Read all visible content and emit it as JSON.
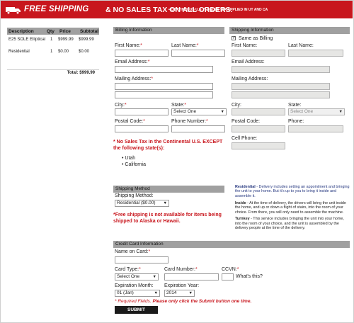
{
  "banner": {
    "free_shipping": "FREE SHIPPING",
    "no_sales_tax": "& NO SALES TAX ON ALL ORDERS.",
    "fine_print": "• CONTINUOUS U.S. ** SALES TAX APPLIED IN UT AND CA"
  },
  "cart": {
    "headers": {
      "description": "Description",
      "qty": "Qty",
      "price": "Price",
      "subtotal": "Subtotal"
    },
    "rows": [
      {
        "description": "E25 SOLE Elliptical",
        "qty": "1",
        "price": "$999.99",
        "subtotal": "$999.99"
      },
      {
        "description": "Residential",
        "qty": "1",
        "price": "$0.00",
        "subtotal": "$0.00"
      }
    ],
    "total_label": "Total: $999.99"
  },
  "billing": {
    "title": "Billing Information",
    "first_name": "First Name:",
    "last_name": "Last Name:",
    "email": "Email Address:",
    "mailing": "Mailing Address:",
    "city": "City:",
    "state": "State:",
    "state_value": "Select One",
    "postal": "Postal Code:",
    "phone": "Phone Number:"
  },
  "shipping": {
    "title": "Shipping Information",
    "same_as_billing": "Same as Billing",
    "first_name": "First Name:",
    "last_name": "Last Name:",
    "email": "Email Address:",
    "mailing": "Mailing Address:",
    "city": "City:",
    "state": "State:",
    "state_value": "Select One",
    "postal": "Postal Code:",
    "phone": "Phone:",
    "cell": "Cell Phone:"
  },
  "tax_note": {
    "line1": "* No Sales Tax in the Continental U.S. EXCEPT",
    "line2": "the following state(s):",
    "states": [
      "Utah",
      "California"
    ]
  },
  "shipping_method": {
    "title": "Shipping Method",
    "label": "Shipping Method:",
    "value": "Residential ($0.00)",
    "note_line1": "*Free shipping is not available for items being",
    "note_line2": "shipped to Alaska or Hawaii."
  },
  "delivery_info": {
    "residential_title": "Residential",
    "residential_text": " - Delivery includes setting an appointment and bringing the unit to your home. But it's up to you to bring it inside and assemble it.",
    "inside_title": "Inside",
    "inside_text": " - At the time of delivery, the drivers will bring the unit inside the home, and up or down a flight of stairs, into the room of your choice. From there, you will only need to assemble the machine.",
    "turnkey_title": "Turnkey",
    "turnkey_text": " - This service includes bringing the unit into your home, into the room of your choice, and the unit is assembled by the delivery people at the time of the delivery."
  },
  "credit_card": {
    "title": "Credit Card Information",
    "name_on_card": "Name on Card:",
    "card_type": "Card Type:",
    "card_type_value": "Select One",
    "card_number": "Card Number:",
    "ccvn": "CCVN:",
    "whats_this": "What's this?",
    "exp_month": "Expiration Month:",
    "exp_month_value": "01 (Jan)",
    "exp_year": "Expiration Year:",
    "exp_year_value": "2014"
  },
  "required_note": "* Required Fields.",
  "required_note_bold": "Please only click the Submit button one time.",
  "submit_label": "SUBMIT",
  "colors": {
    "brand_red": "#c8161d",
    "header_gray": "#a0a0a0",
    "info_blue": "#23357e"
  }
}
